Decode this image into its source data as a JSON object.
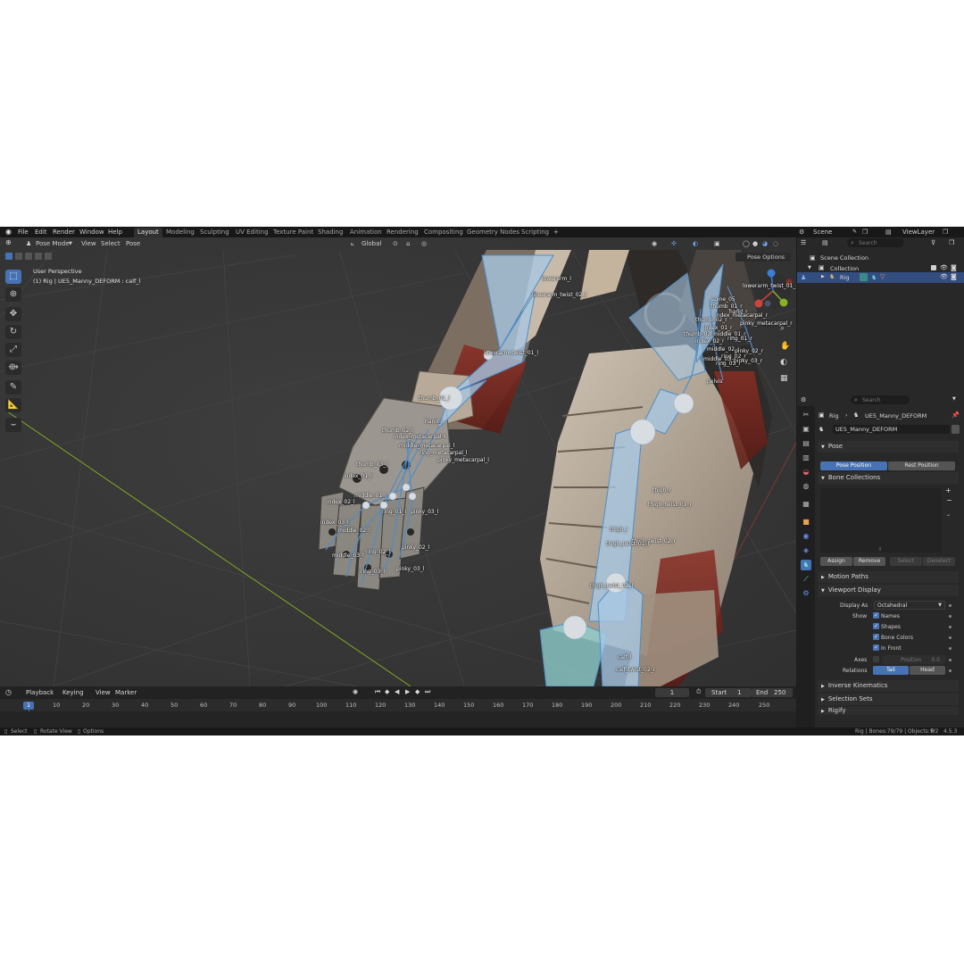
{
  "menu": {
    "logo": "blender-logo-icon",
    "items": [
      "File",
      "Edit",
      "Render",
      "Window",
      "Help"
    ]
  },
  "workspaces": [
    "Layout",
    "Modeling",
    "Sculpting",
    "UV Editing",
    "Texture Paint",
    "Shading",
    "Animation",
    "Rendering",
    "Compositing",
    "Geometry Nodes",
    "Scripting"
  ],
  "workspace_add": "+",
  "scene": {
    "label": "Scene",
    "viewlayer": "ViewLayer"
  },
  "viewport": {
    "mode": "Pose Mode",
    "menus": [
      "View",
      "Select",
      "Pose"
    ],
    "transform_orientation": "Global",
    "pose_options": "Pose Options",
    "overlay_title": "User Perspective",
    "overlay_subtitle": "(1) Rig | UE5_Manny_DEFORM : calf_l",
    "bone_labels": [
      "lowerarm_l",
      "lowerarm_twist_02_l",
      "lowerarm_twist_01_l",
      "thumb_01_l",
      "hand_l",
      "thumb_02_l",
      "index_metacarpal_l",
      "middle_metacarpal_l",
      "ring_metacarpal_l",
      "pinky_metacarpal_l",
      "thumb_03_l",
      "index_01_l",
      "middle_01_l",
      "index_02_l",
      "ring_01_l",
      "pinky_03_l",
      "index_03_l",
      "middle_02_l",
      "ring_02_l",
      "pinky_02_l",
      "middle_03_l",
      "ring_03_l",
      "pinky_03_l",
      "spine_05",
      "thumb_01_r",
      "hand_r",
      "thumb_02_r",
      "index_metacarpal_r",
      "pinky_metacarpal_r",
      "index_01_r",
      "middle_01_r",
      "thumb_03_r",
      "index_02_r",
      "ring_01_r",
      "middle_02_r",
      "pinky_02_r",
      "ring_02_r",
      "middle_03_r",
      "pinky_03_r",
      "ring_03_r",
      "pelvis",
      "lowerarm_twist_01_r",
      "thigh_r",
      "thigh_twist_01_r",
      "thigh_l",
      "thigh_twist_02_r",
      "thigh_twist_01_l",
      "thigh_twist_02_l",
      "calf_l",
      "calf_twist_02_r"
    ]
  },
  "outliner": {
    "search_placeholder": "Search",
    "scene_collection": "Scene Collection",
    "collection": "Collection",
    "rig": "Rig"
  },
  "properties": {
    "search_placeholder": "Search",
    "breadcrumb_object": "Rig",
    "breadcrumb_armature": "UE5_Manny_DEFORM",
    "armature_name": "UE5_Manny_DEFORM",
    "pose_section": "Pose",
    "pose_position": "Pose Position",
    "rest_position": "Rest Position",
    "bone_collections": "Bone Collections",
    "assign": "Assign",
    "remove": "Remove",
    "select": "Select",
    "deselect": "Deselect",
    "motion_paths": "Motion Paths",
    "viewport_display": "Viewport Display",
    "display_as_label": "Display As",
    "display_as_value": "Octahedral",
    "show_label": "Show",
    "show_names": "Names",
    "show_shapes": "Shapes",
    "show_bone_colors": "Bone Colors",
    "show_in_front": "In Front",
    "axes_label": "Axes",
    "position_label": "Position",
    "position_value": "0.0",
    "relations_label": "Relations",
    "tail": "Tail",
    "head": "Head",
    "inverse_kinematics": "Inverse Kinematics",
    "selection_sets": "Selection Sets",
    "rigify": "Rigify"
  },
  "timeline": {
    "menus": [
      "Playback",
      "Keying",
      "View",
      "Marker"
    ],
    "current_frame": "1",
    "start_label": "Start",
    "start_value": "1",
    "end_label": "End",
    "end_value": "250",
    "ticks": [
      "1",
      "10",
      "20",
      "30",
      "40",
      "50",
      "60",
      "70",
      "80",
      "90",
      "100",
      "110",
      "120",
      "130",
      "140",
      "150",
      "160",
      "170",
      "180",
      "190",
      "200",
      "210",
      "220",
      "230",
      "240",
      "250"
    ]
  },
  "status": {
    "select": "Select",
    "rotate_view": "Rotate View",
    "options": "Options",
    "stats": "Rig | Bones:79/79 | Objects:1/2",
    "version": "4.5.3"
  },
  "colors": {
    "accent": "#4772b3",
    "bone": "#8db4d9",
    "x_axis": "#c8463e",
    "y_axis": "#86b322",
    "z_axis": "#3c7dd8"
  }
}
